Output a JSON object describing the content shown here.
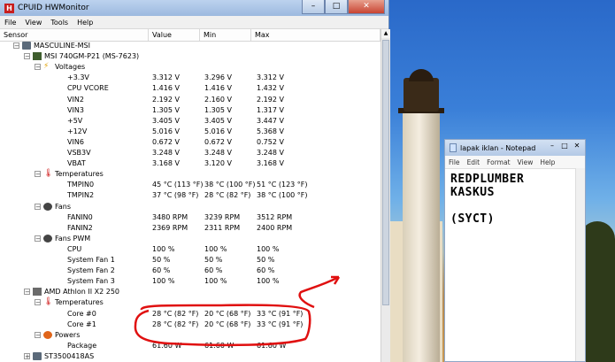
{
  "hwmonitor": {
    "title": "CPUID HWMonitor",
    "app_icon_letter": "H",
    "window_buttons": {
      "minimize": "–",
      "maximize": "□",
      "close": "✕"
    },
    "menu": [
      "File",
      "View",
      "Tools",
      "Help"
    ],
    "columns": [
      "Sensor",
      "Value",
      "Min",
      "Max"
    ],
    "rows": [
      {
        "name": "MASCULINE-MSI",
        "level": 0,
        "icon": "computer-icon",
        "toggle": "−",
        "value": "",
        "min": "",
        "max": ""
      },
      {
        "name": "MSI 740GM-P21 (MS-7623)",
        "level": 1,
        "icon": "motherboard-icon",
        "toggle": "−",
        "value": "",
        "min": "",
        "max": ""
      },
      {
        "name": "Voltages",
        "level": 2,
        "icon": "voltage-icon",
        "toggle": "−",
        "value": "",
        "min": "",
        "max": ""
      },
      {
        "name": "+3.3V",
        "level": 3,
        "value": "3.312 V",
        "min": "3.296 V",
        "max": "3.312 V"
      },
      {
        "name": "CPU VCORE",
        "level": 3,
        "value": "1.416 V",
        "min": "1.416 V",
        "max": "1.432 V"
      },
      {
        "name": "VIN2",
        "level": 3,
        "value": "2.192 V",
        "min": "2.160 V",
        "max": "2.192 V"
      },
      {
        "name": "VIN3",
        "level": 3,
        "value": "1.305 V",
        "min": "1.305 V",
        "max": "1.317 V"
      },
      {
        "name": "+5V",
        "level": 3,
        "value": "3.405 V",
        "min": "3.405 V",
        "max": "3.447 V"
      },
      {
        "name": "+12V",
        "level": 3,
        "value": "5.016 V",
        "min": "5.016 V",
        "max": "5.368 V"
      },
      {
        "name": "VIN6",
        "level": 3,
        "value": "0.672 V",
        "min": "0.672 V",
        "max": "0.752 V"
      },
      {
        "name": "VSB3V",
        "level": 3,
        "value": "3.248 V",
        "min": "3.248 V",
        "max": "3.248 V"
      },
      {
        "name": "VBAT",
        "level": 3,
        "value": "3.168 V",
        "min": "3.120 V",
        "max": "3.168 V"
      },
      {
        "name": "Temperatures",
        "level": 2,
        "icon": "thermometer-icon",
        "toggle": "−",
        "value": "",
        "min": "",
        "max": ""
      },
      {
        "name": "TMPIN0",
        "level": 3,
        "value": "45 °C  (113 °F)",
        "min": "38 °C  (100 °F)",
        "max": "51 °C  (123 °F)"
      },
      {
        "name": "TMPIN2",
        "level": 3,
        "value": "37 °C  (98 °F)",
        "min": "28 °C  (82 °F)",
        "max": "38 °C  (100 °F)"
      },
      {
        "name": "Fans",
        "level": 2,
        "icon": "fan-icon",
        "toggle": "−",
        "value": "",
        "min": "",
        "max": ""
      },
      {
        "name": "FANIN0",
        "level": 3,
        "value": "3480 RPM",
        "min": "3239 RPM",
        "max": "3512 RPM"
      },
      {
        "name": "FANIN2",
        "level": 3,
        "value": "2369 RPM",
        "min": "2311 RPM",
        "max": "2400 RPM"
      },
      {
        "name": "Fans PWM",
        "level": 2,
        "icon": "fan-icon",
        "toggle": "−",
        "value": "",
        "min": "",
        "max": ""
      },
      {
        "name": "CPU",
        "level": 3,
        "value": "100 %",
        "min": "100 %",
        "max": "100 %"
      },
      {
        "name": "System Fan 1",
        "level": 3,
        "value": "50 %",
        "min": "50 %",
        "max": "50 %"
      },
      {
        "name": "System Fan 2",
        "level": 3,
        "value": "60 %",
        "min": "60 %",
        "max": "60 %"
      },
      {
        "name": "System Fan 3",
        "level": 3,
        "value": "100 %",
        "min": "100 %",
        "max": "100 %"
      },
      {
        "name": "AMD Athlon II X2 250",
        "level": 1,
        "icon": "cpu-icon",
        "toggle": "−",
        "value": "",
        "min": "",
        "max": ""
      },
      {
        "name": "Temperatures",
        "level": 2,
        "icon": "thermometer-icon",
        "toggle": "−",
        "value": "",
        "min": "",
        "max": ""
      },
      {
        "name": "Core #0",
        "level": 3,
        "value": "28 °C  (82 °F)",
        "min": "20 °C  (68 °F)",
        "max": "33 °C  (91 °F)"
      },
      {
        "name": "Core #1",
        "level": 3,
        "value": "28 °C  (82 °F)",
        "min": "20 °C  (68 °F)",
        "max": "33 °C  (91 °F)"
      },
      {
        "name": "Powers",
        "level": 2,
        "icon": "power-icon",
        "toggle": "−",
        "value": "",
        "min": "",
        "max": ""
      },
      {
        "name": "Package",
        "level": 3,
        "value": "61.60 W",
        "min": "61.60 W",
        "max": "61.60 W"
      },
      {
        "name": "ST3500418AS",
        "level": 1,
        "icon": "hdd-icon",
        "toggle": "+",
        "value": "",
        "min": "",
        "max": ""
      }
    ]
  },
  "notepad": {
    "title": "lapak iklan - Notepad",
    "window_buttons": {
      "minimize": "–",
      "maximize": "□",
      "close": "✕"
    },
    "menu": [
      "File",
      "Edit",
      "Format",
      "View",
      "Help"
    ],
    "lines": [
      "REDPLUMBER",
      "KASKUS",
      "",
      "(SYCT)"
    ]
  },
  "annotation_color": "#e01010"
}
